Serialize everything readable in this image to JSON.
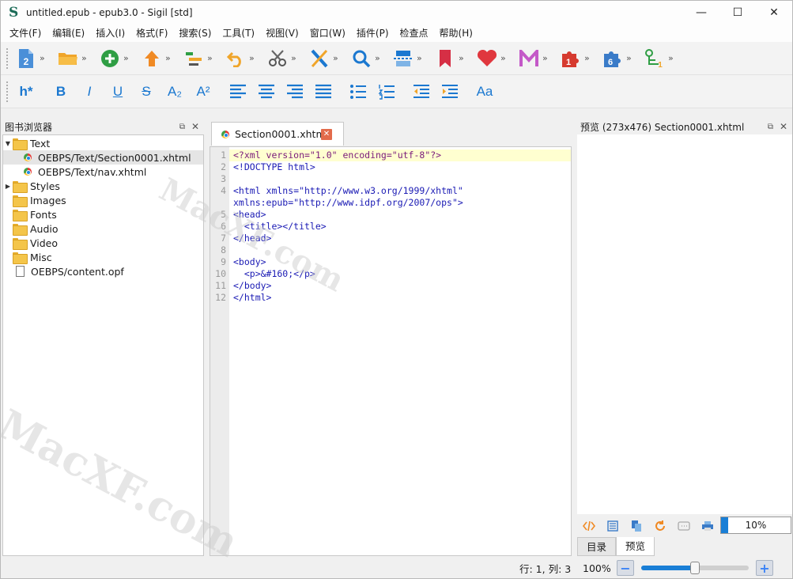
{
  "window": {
    "title": "untitled.epub - epub3.0 - Sigil [std]",
    "app_icon": "S",
    "controls": {
      "minimize": "—",
      "maximize": "☐",
      "close": "✕"
    }
  },
  "menu": [
    "文件(F)",
    "编辑(E)",
    "插入(I)",
    "格式(F)",
    "搜索(S)",
    "工具(T)",
    "视图(V)",
    "窗口(W)",
    "插件(P)",
    "检查点",
    "帮助(H)"
  ],
  "toolbar1": {
    "overflow": "»",
    "icons": [
      "new-file-icon",
      "open-folder-icon",
      "add-icon",
      "upload-arrow-icon",
      "structure-icon",
      "undo-icon",
      "cut-icon",
      "code-tool-icon",
      "search-icon",
      "split-icon",
      "bookmark-icon",
      "heart-icon",
      "m-logo-icon",
      "plugin-1-icon",
      "plugin-6-icon",
      "tree-tool-icon"
    ],
    "badges": {
      "new_file": "2",
      "plugin_1": "1",
      "plugin_6": "6",
      "tree_tool": "1"
    }
  },
  "toolbar2": {
    "heading": "h*",
    "bold": "B",
    "italic": "I",
    "underline": "U",
    "strike": "S",
    "subscript": "A₂",
    "superscript": "A²",
    "case": "Aa"
  },
  "book_browser": {
    "title": "图书浏览器",
    "dock": "⧉",
    "close": "✕",
    "items": [
      {
        "label": "Text",
        "type": "folder",
        "expanded": true
      },
      {
        "label": "OEBPS/Text/Section0001.xhtml",
        "type": "xhtml",
        "selected": true
      },
      {
        "label": "OEBPS/Text/nav.xhtml",
        "type": "xhtml"
      },
      {
        "label": "Styles",
        "type": "folder",
        "expandable": true
      },
      {
        "label": "Images",
        "type": "folder"
      },
      {
        "label": "Fonts",
        "type": "folder"
      },
      {
        "label": "Audio",
        "type": "folder"
      },
      {
        "label": "Video",
        "type": "folder"
      },
      {
        "label": "Misc",
        "type": "folder"
      },
      {
        "label": "OEBPS/content.opf",
        "type": "file"
      }
    ]
  },
  "editor": {
    "tab_label": "Section0001.xhtml",
    "tab_close": "✕",
    "line_numbers": [
      "1",
      "2",
      "3",
      "4",
      "5",
      "6",
      "7",
      "8",
      "9",
      "10",
      "11",
      "12"
    ],
    "lines": [
      "<?xml version=\"1.0\" encoding=\"utf-8\"?>",
      "<!DOCTYPE html>",
      "",
      "<html xmlns=\"http://www.w3.org/1999/xhtml\"",
      "xmlns:epub=\"http://www.idpf.org/2007/ops\">",
      "<head>",
      "  <title></title>",
      "</head>",
      "",
      "<body>",
      "  <p>&#160;</p>",
      "</body>",
      "</html>"
    ]
  },
  "preview": {
    "title": "预览 (273x476) Section0001.xhtml",
    "dock": "⧉",
    "close": "✕",
    "zoom_value": "10%",
    "zoom_fraction": 0.1,
    "tabs": [
      "目录",
      "预览"
    ],
    "tool_icons": [
      "code-icon",
      "toc-icon",
      "copy-icon",
      "refresh-icon",
      "inspect-icon",
      "print-icon"
    ]
  },
  "status": {
    "position": "行: 1, 列: 3",
    "zoom": "100%",
    "zoom_minus": "−",
    "zoom_plus": "+",
    "zoom_fraction": 0.5
  },
  "watermark": "MacXF.com"
}
